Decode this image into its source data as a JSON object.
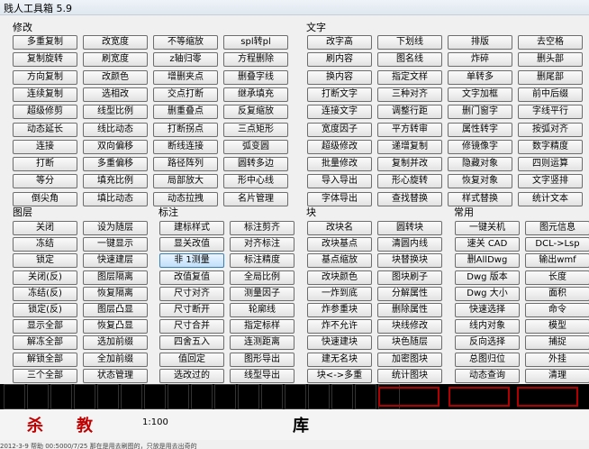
{
  "window": {
    "title": "贱人工具箱 5.9"
  },
  "groups": {
    "modify": "修改",
    "text": "文字",
    "layer": "图层",
    "annot": "标注",
    "block": "块",
    "common": "常用"
  },
  "modify": [
    [
      "多重复制",
      "改宽度",
      "不等缩放",
      "spl转pl"
    ],
    [
      "复制旋转",
      "刷宽度",
      "z轴归零",
      "方程删除"
    ],
    [
      "方向复制",
      "改颜色",
      "增删夹点",
      "删叠字线"
    ],
    [
      "连续复制",
      "选相改",
      "交点打断",
      "继承填充"
    ],
    [
      "超级修剪",
      "线型比例",
      "删重叠点",
      "反复缩放"
    ],
    [
      "动态延长",
      "线比动态",
      "打断拐点",
      "三点矩形"
    ],
    [
      "连接",
      "双向偏移",
      "断线连接",
      "弧变圆"
    ],
    [
      "打断",
      "多重偏移",
      "路径阵列",
      "圆转多边"
    ],
    [
      "等分",
      "填充比例",
      "局部放大",
      "形中心线"
    ],
    [
      "倒尖角",
      "填比动态",
      "动态拉拽",
      "名片管理"
    ]
  ],
  "text": [
    [
      "改字高",
      "下划线",
      "排版",
      "去空格"
    ],
    [
      "刷内容",
      "图名线",
      "炸碎",
      "删头部"
    ],
    [
      "换内容",
      "指定文样",
      "单转多",
      "删尾部"
    ],
    [
      "打断文字",
      "三种对齐",
      "文字加框",
      "前中后缀"
    ],
    [
      "连接文字",
      "调整行距",
      "删门窗字",
      "字线平行"
    ],
    [
      "宽度因子",
      "平方转审",
      "属性转字",
      "按弧对齐"
    ],
    [
      "超级修改",
      "递增复制",
      "修镜像字",
      "数字精度"
    ],
    [
      "批量修改",
      "复制并改",
      "隐藏对象",
      "四则运算"
    ],
    [
      "导入导出",
      "形心旋转",
      "恢复对象",
      "文字竖排"
    ],
    [
      "字体导出",
      "查找替换",
      "样式替换",
      "统计文本"
    ]
  ],
  "layer": [
    [
      "关闭",
      "设为随层"
    ],
    [
      "冻结",
      "一键显示"
    ],
    [
      "锁定",
      "快速建层"
    ],
    [
      "关闭(反)",
      "图层隔离"
    ],
    [
      "冻结(反)",
      "恢复隔离"
    ],
    [
      "锁定(反)",
      "图层凸显"
    ],
    [
      "显示全部",
      "恢复凸显"
    ],
    [
      "解冻全部",
      "选加前缀"
    ],
    [
      "解锁全部",
      "全加前缀"
    ],
    [
      "三个全部",
      "状态管理"
    ]
  ],
  "annot": [
    [
      "建标样式",
      "标注剪齐"
    ],
    [
      "显关改值",
      "对齐标注"
    ],
    [
      "非 1测量",
      "标注精度"
    ],
    [
      "改值复值",
      "全局比例"
    ],
    [
      "尺寸对齐",
      "测量因子"
    ],
    [
      "尺寸断开",
      "轮廓线"
    ],
    [
      "尺寸合并",
      "指定标样"
    ],
    [
      "四舍五入",
      "连测距离"
    ],
    [
      "值回定",
      "图形导出"
    ],
    [
      "选改过的",
      "线型导出"
    ]
  ],
  "block": [
    [
      "改块名",
      "圆转块"
    ],
    [
      "改块基点",
      "清圆内线"
    ],
    [
      "基点缩放",
      "块替换块"
    ],
    [
      "改块颜色",
      "图块刷子"
    ],
    [
      "一炸到底",
      "分解属性"
    ],
    [
      "炸参重块",
      "删除属性"
    ],
    [
      "炸不允许",
      "块线修改"
    ],
    [
      "快速建块",
      "块色随层"
    ],
    [
      "建无名块",
      "加密图块"
    ],
    [
      "块<->多重",
      "统计图块"
    ]
  ],
  "common": [
    [
      "一键关机",
      "图元信息"
    ],
    [
      "速关 CAD",
      "DCL->Lsp"
    ],
    [
      "删AllDwg",
      "输出wmf"
    ],
    [
      "Dwg 版本",
      "长度"
    ],
    [
      "Dwg 大小",
      "面积"
    ],
    [
      "快速选择",
      "命令"
    ],
    [
      "线内对象",
      "模型"
    ],
    [
      "反向选择",
      "捕捉"
    ],
    [
      "总图归位",
      "外挂"
    ],
    [
      "动态查询",
      "清理"
    ]
  ],
  "status": {
    "text": "2012-3-9    帮助    00:5000/7/25          那在是用去刷图的，只放是用去出奇的"
  },
  "ribbon": {
    "t1": "杀",
    "t2": "教",
    "t3": "库",
    "t4": "1:100"
  }
}
